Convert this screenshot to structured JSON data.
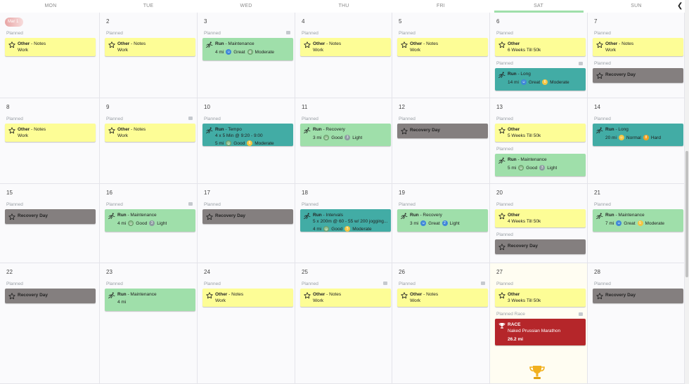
{
  "header": {
    "days": [
      "MON",
      "TUE",
      "WED",
      "THU",
      "FRI",
      "SAT",
      "SUN"
    ]
  },
  "weeks": [
    {
      "days": [
        {
          "date": "Mar 1",
          "today": true,
          "events": [
            {
              "label": "Planned",
              "cards": [
                {
                  "color": "yellow",
                  "icon": "star",
                  "title": "Other",
                  "suffix": " - Notes",
                  "line2": "Work"
                }
              ]
            }
          ]
        },
        {
          "date": "2",
          "events": [
            {
              "label": "Planned",
              "cards": [
                {
                  "color": "yellow",
                  "icon": "star",
                  "title": "Other",
                  "suffix": " - Notes",
                  "line2": "Work"
                }
              ]
            }
          ]
        },
        {
          "date": "3",
          "comment": true,
          "events": [
            {
              "label": "Planned",
              "cards": [
                {
                  "color": "green",
                  "icon": "run",
                  "title": "Run",
                  "suffix": " - Maintenance",
                  "dist": "4 mi",
                  "feel_icon": "b-blue",
                  "feel": "Great",
                  "effort_num": "4",
                  "effort_icon": "b-sage",
                  "effort": "Moderate"
                }
              ]
            }
          ]
        },
        {
          "date": "4",
          "events": [
            {
              "label": "Planned",
              "cards": [
                {
                  "color": "yellow",
                  "icon": "star",
                  "title": "Other",
                  "suffix": " - Notes",
                  "line2": "Work"
                }
              ]
            }
          ]
        },
        {
          "date": "5",
          "events": [
            {
              "label": "Planned",
              "cards": [
                {
                  "color": "yellow",
                  "icon": "star",
                  "title": "Other",
                  "suffix": " - Notes",
                  "line2": "Work"
                }
              ]
            }
          ]
        },
        {
          "date": "6",
          "events": [
            {
              "label": "Planned",
              "cards": [
                {
                  "color": "yellow",
                  "icon": "star",
                  "title": "Other",
                  "suffix": "",
                  "line2": "6 Weeks Till 50k"
                }
              ]
            },
            {
              "label": "Planned",
              "comment": true,
              "cards": [
                {
                  "color": "teal",
                  "icon": "run",
                  "title": "Run",
                  "suffix": " - Long",
                  "dist": "14 mi",
                  "feel_icon": "b-blue",
                  "feel": "Great",
                  "effort_num": "6",
                  "effort_icon": "b-yellow",
                  "effort": "Moderate"
                }
              ]
            }
          ]
        },
        {
          "date": "7",
          "events": [
            {
              "label": "Planned",
              "cards": [
                {
                  "color": "yellow",
                  "icon": "star",
                  "title": "Other",
                  "suffix": " - Notes",
                  "line2": "Work"
                }
              ]
            },
            {
              "label": "Planned",
              "cards": [
                {
                  "color": "gray",
                  "icon": "star",
                  "title": "Recovery Day",
                  "suffix": ""
                }
              ]
            }
          ]
        }
      ]
    },
    {
      "days": [
        {
          "date": "8",
          "events": [
            {
              "label": "Planned",
              "cards": [
                {
                  "color": "yellow",
                  "icon": "star",
                  "title": "Other",
                  "suffix": " - Notes",
                  "line2": "Work"
                }
              ]
            }
          ]
        },
        {
          "date": "9",
          "comment": true,
          "events": [
            {
              "label": "Planned",
              "cards": [
                {
                  "color": "yellow",
                  "icon": "star",
                  "title": "Other",
                  "suffix": " - Notes",
                  "line2": "Work"
                }
              ]
            }
          ]
        },
        {
          "date": "10",
          "events": [
            {
              "label": "Planned",
              "cards": [
                {
                  "color": "teal",
                  "icon": "run",
                  "title": "Run",
                  "suffix": " - Tempo",
                  "line2": "4 x 5 Min @ 9:20 - 9:00",
                  "dist": "5 mi",
                  "feel_icon": "b-sage",
                  "feel": "Good",
                  "effort_num": "6",
                  "effort_icon": "b-yellow",
                  "effort": "Moderate"
                }
              ]
            }
          ]
        },
        {
          "date": "11",
          "events": [
            {
              "label": "Planned",
              "cards": [
                {
                  "color": "green",
                  "icon": "run",
                  "title": "Run",
                  "suffix": " - Recovery",
                  "dist": "3 mi",
                  "feel_icon": "b-sage",
                  "feel": "Good",
                  "effort_num": "3",
                  "effort_icon": "b-gray",
                  "effort": "Light"
                }
              ]
            }
          ]
        },
        {
          "date": "12",
          "events": [
            {
              "label": "Planned",
              "cards": [
                {
                  "color": "gray",
                  "icon": "star",
                  "title": "Recovery Day",
                  "suffix": ""
                }
              ]
            }
          ]
        },
        {
          "date": "13",
          "events": [
            {
              "label": "Planned",
              "cards": [
                {
                  "color": "yellow",
                  "icon": "star",
                  "title": "Other",
                  "suffix": "",
                  "line2": "5 Weeks Till 50k"
                }
              ]
            },
            {
              "label": "Planned",
              "cards": [
                {
                  "color": "green",
                  "icon": "run",
                  "title": "Run",
                  "suffix": " - Maintenance",
                  "dist": "5 mi",
                  "feel_icon": "b-sage",
                  "feel": "Good",
                  "effort_num": "3",
                  "effort_icon": "b-gray",
                  "effort": "Light"
                }
              ]
            }
          ]
        },
        {
          "date": "14",
          "events": [
            {
              "label": "Planned",
              "cards": [
                {
                  "color": "teal",
                  "icon": "run",
                  "title": "Run",
                  "suffix": " - Long",
                  "dist": "20 mi",
                  "feel_icon": "b-yellow",
                  "feel": "Normal",
                  "effort_num": "8",
                  "effort_icon": "b-orange",
                  "effort": "Hard"
                }
              ]
            }
          ]
        }
      ]
    },
    {
      "days": [
        {
          "date": "15",
          "events": [
            {
              "label": "Planned",
              "cards": [
                {
                  "color": "gray",
                  "icon": "star",
                  "title": "Recovery Day",
                  "suffix": ""
                }
              ]
            }
          ]
        },
        {
          "date": "16",
          "comment": true,
          "events": [
            {
              "label": "Planned",
              "cards": [
                {
                  "color": "green",
                  "icon": "run",
                  "title": "Run",
                  "suffix": " - Maintenance",
                  "dist": "4 mi",
                  "feel_icon": "b-sage",
                  "feel": "Good",
                  "effort_num": "3",
                  "effort_icon": "b-gray",
                  "effort": "Light"
                }
              ]
            }
          ]
        },
        {
          "date": "17",
          "events": [
            {
              "label": "Planned",
              "cards": [
                {
                  "color": "gray",
                  "icon": "star",
                  "title": "Recovery Day",
                  "suffix": ""
                }
              ]
            }
          ]
        },
        {
          "date": "18",
          "events": [
            {
              "label": "Planned",
              "cards": [
                {
                  "color": "teal",
                  "icon": "run",
                  "title": "Run",
                  "suffix": " - Intervals",
                  "line2": "5 x 200m @ 60 - 55 w/ 200 jogging...",
                  "dist": "4 mi",
                  "feel_icon": "b-sage",
                  "feel": "Good",
                  "effort_num": "5",
                  "effort_icon": "b-yellow",
                  "effort": "Moderate"
                }
              ]
            }
          ]
        },
        {
          "date": "19",
          "events": [
            {
              "label": "Planned",
              "cards": [
                {
                  "color": "green",
                  "icon": "run",
                  "title": "Run",
                  "suffix": " - Recovery",
                  "dist": "3 mi",
                  "feel_icon": "b-blue",
                  "feel": "Great",
                  "effort_num": "2",
                  "effort_icon": "b-blue",
                  "effort": "Light"
                }
              ]
            }
          ]
        },
        {
          "date": "20",
          "events": [
            {
              "label": "Planned",
              "cards": [
                {
                  "color": "yellow",
                  "icon": "star",
                  "title": "Other",
                  "suffix": "",
                  "line2": "4 Weeks Till 50k"
                }
              ]
            },
            {
              "label": "Planned",
              "cards": [
                {
                  "color": "gray",
                  "icon": "star",
                  "title": "Recovery Day",
                  "suffix": ""
                }
              ]
            }
          ]
        },
        {
          "date": "21",
          "events": [
            {
              "label": "Planned",
              "cards": [
                {
                  "color": "green",
                  "icon": "run",
                  "title": "Run",
                  "suffix": " - Maintenance",
                  "dist": "7 mi",
                  "feel_icon": "b-blue",
                  "feel": "Great",
                  "effort_num": "5",
                  "effort_icon": "b-yellow",
                  "effort": "Moderate"
                }
              ]
            }
          ]
        }
      ]
    },
    {
      "days": [
        {
          "date": "22",
          "events": [
            {
              "label": "Planned",
              "cards": [
                {
                  "color": "gray",
                  "icon": "star",
                  "title": "Recovery Day",
                  "suffix": ""
                }
              ]
            }
          ]
        },
        {
          "date": "23",
          "events": [
            {
              "label": "Planned",
              "cards": [
                {
                  "color": "green",
                  "icon": "run",
                  "title": "Run",
                  "suffix": " - Maintenance",
                  "dist": "4 mi"
                }
              ]
            }
          ]
        },
        {
          "date": "24",
          "events": [
            {
              "label": "Planned",
              "cards": [
                {
                  "color": "yellow",
                  "icon": "star",
                  "title": "Other",
                  "suffix": " - Notes",
                  "line2": "Work"
                }
              ]
            }
          ]
        },
        {
          "date": "25",
          "comment": true,
          "events": [
            {
              "label": "Planned",
              "cards": [
                {
                  "color": "yellow",
                  "icon": "star",
                  "title": "Other",
                  "suffix": " - Notes",
                  "line2": "Work"
                }
              ]
            }
          ]
        },
        {
          "date": "26",
          "comment": true,
          "events": [
            {
              "label": "Planned",
              "cards": [
                {
                  "color": "yellow",
                  "icon": "star",
                  "title": "Other",
                  "suffix": " - Notes",
                  "line2": "Work"
                }
              ]
            }
          ]
        },
        {
          "date": "27",
          "highlight": true,
          "trophy": true,
          "events": [
            {
              "label": "Planned",
              "cards": [
                {
                  "color": "yellow",
                  "icon": "star",
                  "title": "Other",
                  "suffix": "",
                  "line2": "3 Weeks Till 50k"
                }
              ]
            },
            {
              "label": "Planned Race",
              "comment": true,
              "cards": [
                {
                  "color": "red",
                  "icon": "trophy",
                  "title": "RACE",
                  "suffix": "",
                  "line2": "Naked Prussian Marathon",
                  "line3": "26.2 mi"
                }
              ]
            }
          ]
        },
        {
          "date": "28",
          "events": [
            {
              "label": "Planned",
              "cards": [
                {
                  "color": "gray",
                  "icon": "star",
                  "title": "Recovery Day",
                  "suffix": ""
                }
              ]
            }
          ]
        }
      ]
    }
  ]
}
